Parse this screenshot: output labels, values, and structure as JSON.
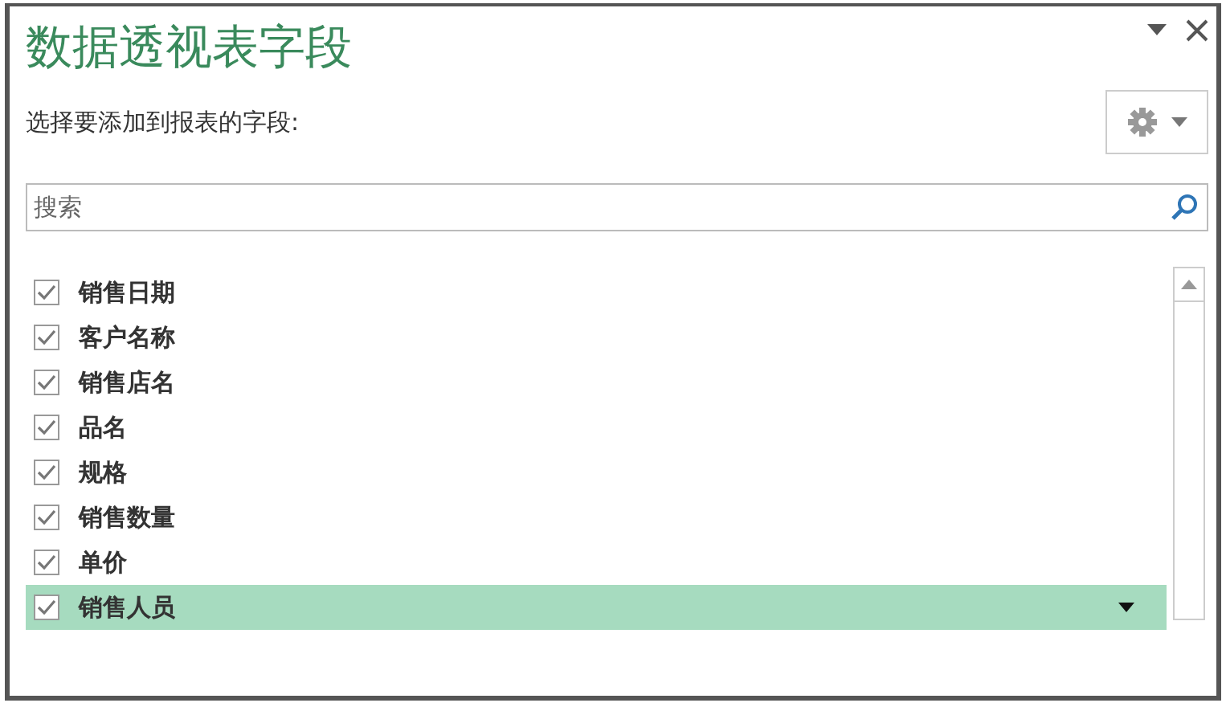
{
  "panel": {
    "title": "数据透视表字段",
    "subtitle": "选择要添加到报表的字段:"
  },
  "search": {
    "placeholder": "搜索"
  },
  "fields": [
    {
      "label": "销售日期",
      "checked": true,
      "selected": false
    },
    {
      "label": "客户名称",
      "checked": true,
      "selected": false
    },
    {
      "label": "销售店名",
      "checked": true,
      "selected": false
    },
    {
      "label": "品名",
      "checked": true,
      "selected": false
    },
    {
      "label": "规格",
      "checked": true,
      "selected": false
    },
    {
      "label": "销售数量",
      "checked": true,
      "selected": false
    },
    {
      "label": "单价",
      "checked": true,
      "selected": false
    },
    {
      "label": "销售人员",
      "checked": true,
      "selected": true
    }
  ]
}
